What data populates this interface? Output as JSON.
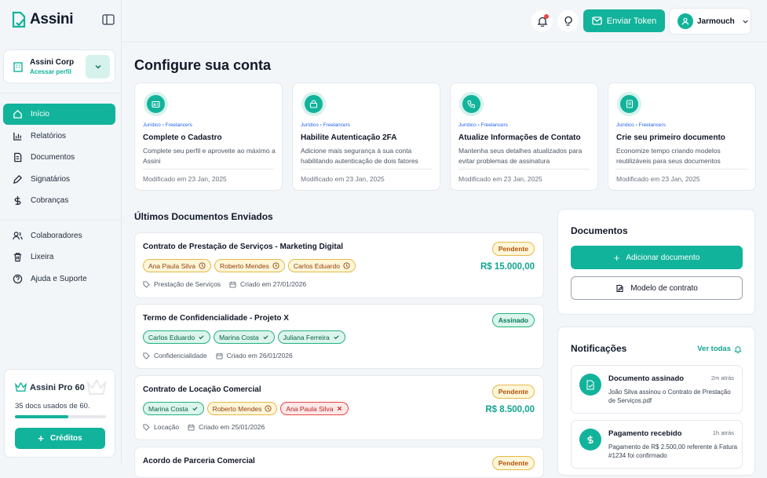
{
  "sidebar": {
    "logo": "Assini",
    "company": {
      "name": "Assini Corp",
      "link": "Acessar perfil"
    },
    "nav": [
      {
        "label": "Início",
        "icon": "home-icon"
      },
      {
        "label": "Relatórios",
        "icon": "bar-chart-icon"
      },
      {
        "label": "Documentos",
        "icon": "document-icon"
      },
      {
        "label": "Signatários",
        "icon": "pen-icon"
      },
      {
        "label": "Cobranças",
        "icon": "dollar-icon"
      }
    ],
    "nav2": [
      {
        "label": "Colaboradores",
        "icon": "users-icon"
      },
      {
        "label": "Lixeira",
        "icon": "trash-icon"
      },
      {
        "label": "Ajuda e Suporte",
        "icon": "help-icon"
      }
    ],
    "plan": {
      "title": "Assini Pro 60",
      "usage": "35 docs usados de 60.",
      "usage_fraction": 0.583,
      "button": "Créditos"
    }
  },
  "topbar": {
    "send_token": "Enviar Token",
    "user": "Jarmouch"
  },
  "main": {
    "title": "Configure sua conta",
    "cards": [
      {
        "crumb1": "Jurídico",
        "crumb2": "Freelancers",
        "title": "Complete o Cadastro",
        "desc": "Complete seu perfil e aproveite ao máximo a Assini",
        "modified": "Modificado em 23 Jan, 2025"
      },
      {
        "crumb1": "Jurídico",
        "crumb2": "Freelancers",
        "title": "Habilite Autenticação 2FA",
        "desc": "Adicione mais segurança à sua conta habilitando autenticação de dois fatores",
        "modified": "Modificado em 23 Jan, 2025"
      },
      {
        "crumb1": "Jurídico",
        "crumb2": "Freelancers",
        "title": "Atualize Informações de Contato",
        "desc": "Mantenha seus detalhes atualizados para evitar problemas de assinatura",
        "modified": "Modificado em 23 Jan, 2025"
      },
      {
        "crumb1": "Jurídico",
        "crumb2": "Freelancers",
        "title": "Crie seu primeiro documento",
        "desc": "Economize tempo criando modelos reutilizáveis para seus documentos",
        "modified": "Modificado em 23 Jan, 2025"
      }
    ],
    "docs_title": "Últimos Documentos Enviados",
    "docs": [
      {
        "title": "Contrato de Prestação de Serviços - Marketing Digital",
        "status": "Pendente",
        "amount": "R$ 15.000,00",
        "signers": [
          "Ana Paula Silva",
          "Roberto Mendes",
          "Carlos Eduardo"
        ],
        "tag": "Prestação de Serviços",
        "created": "Criado em 27/01/2026"
      },
      {
        "title": "Termo de Confidencialidade - Projeto X",
        "status": "Assinado",
        "amount": "",
        "signers": [
          "Carlos Eduardo",
          "Marina Costa",
          "Juliana Ferreira"
        ],
        "tag": "Confidencialidade",
        "created": "Criado em 26/01/2026"
      },
      {
        "title": "Contrato de Locação Comercial",
        "status": "Pendente",
        "amount": "R$ 8.500,00",
        "signers": [
          "Marina Costa",
          "Roberto Mendes",
          "Ana Paula Silva"
        ],
        "tag": "Locação",
        "created": "Criado em 25/01/2026"
      },
      {
        "title": "Acordo de Parceria Comercial",
        "status": "Pendente"
      }
    ]
  },
  "panel": {
    "title": "Documentos",
    "add": "Adicionar documento",
    "template": "Modelo de contrato",
    "notif_title": "Notificações",
    "see_all": "Ver todas",
    "notifs": [
      {
        "title": "Documento assinado",
        "time": "2m atrás",
        "desc": "João Silva assinou o Contrato de Prestação de Serviços.pdf"
      },
      {
        "title": "Pagamento recebido",
        "time": "1h atrás",
        "desc": "Pagamento de R$ 2.500,00 referente à Fatura #1234 foi confirmado"
      }
    ]
  }
}
